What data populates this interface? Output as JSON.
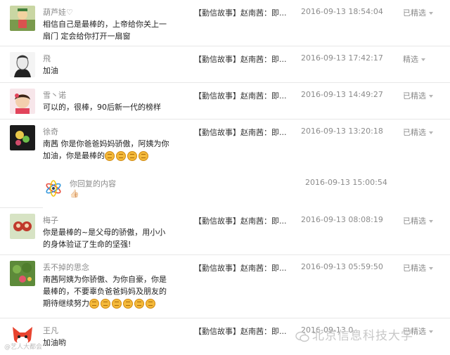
{
  "comments": [
    {
      "nickname": "葫芦娃♡",
      "content": "相信自己是最棒的，上帝给你关上一扇门 定会给你打开一扇窗",
      "article": "【勤信故事】赵南茜：即...",
      "time": "2016-09-13 18:54:04",
      "status": "已精选",
      "avatar_icon": "cartoon-avatar"
    },
    {
      "nickname": "飛",
      "content": "加油",
      "article": "【勤信故事】赵南茜：即...",
      "time": "2016-09-13 17:42:17",
      "status": "精选",
      "avatar_icon": "man-portrait-avatar"
    },
    {
      "nickname": "雪丶诺",
      "content": "可以的，很棒，90后新一代的榜样",
      "article": "【勤信故事】赵南茜：即...",
      "time": "2016-09-13 14:49:27",
      "status": "已精选",
      "avatar_icon": "girl-avatar"
    },
    {
      "nickname": "徐奇",
      "content": "南茜 你是你爸爸妈妈骄傲，阿姨为你加油，你是最棒的",
      "article": "【勤信故事】赵南茜：即...",
      "time": "2016-09-13 13:20:18",
      "status": "已精选",
      "avatar_icon": "flower-avatar",
      "emoji_count": 4
    },
    {
      "nickname": "梅子",
      "content": "你是最棒的~是父母的骄傲，用小小的身体验证了生命的坚强!",
      "article": "【勤信故事】赵南茜：即...",
      "time": "2016-09-13 08:08:19",
      "status": "已精选",
      "avatar_icon": "dolls-avatar"
    },
    {
      "nickname": "丢不掉的思念",
      "content": "南茜阿姨为你骄傲、为你自豪，你是最棒的，不要辜负爸爸妈妈及朋友的期待继续努力",
      "article": "【勤信故事】赵南茜：即...",
      "time": "2016-09-13 05:59:50",
      "status": "已精选",
      "avatar_icon": "garden-avatar",
      "emoji_count": 6
    },
    {
      "nickname": "王凡",
      "content": "加油哟",
      "article": "【勤信故事】赵南茜：即...",
      "time": "2016-09-13 0...",
      "status": "已精选",
      "avatar_icon": "fox-avatar"
    }
  ],
  "reply": {
    "title": "你回复的内容",
    "time": "2016-09-13 15:00:54",
    "body": "👍🏻",
    "logo_icon": "official-account-logo-icon"
  },
  "watermarks": {
    "left": "@艺人大都会",
    "right": "北京信息科技大学"
  },
  "colors": {
    "row_border": "#e7e7e7",
    "meta_text": "#8b8b8b",
    "emoji": "#f4b93a"
  }
}
